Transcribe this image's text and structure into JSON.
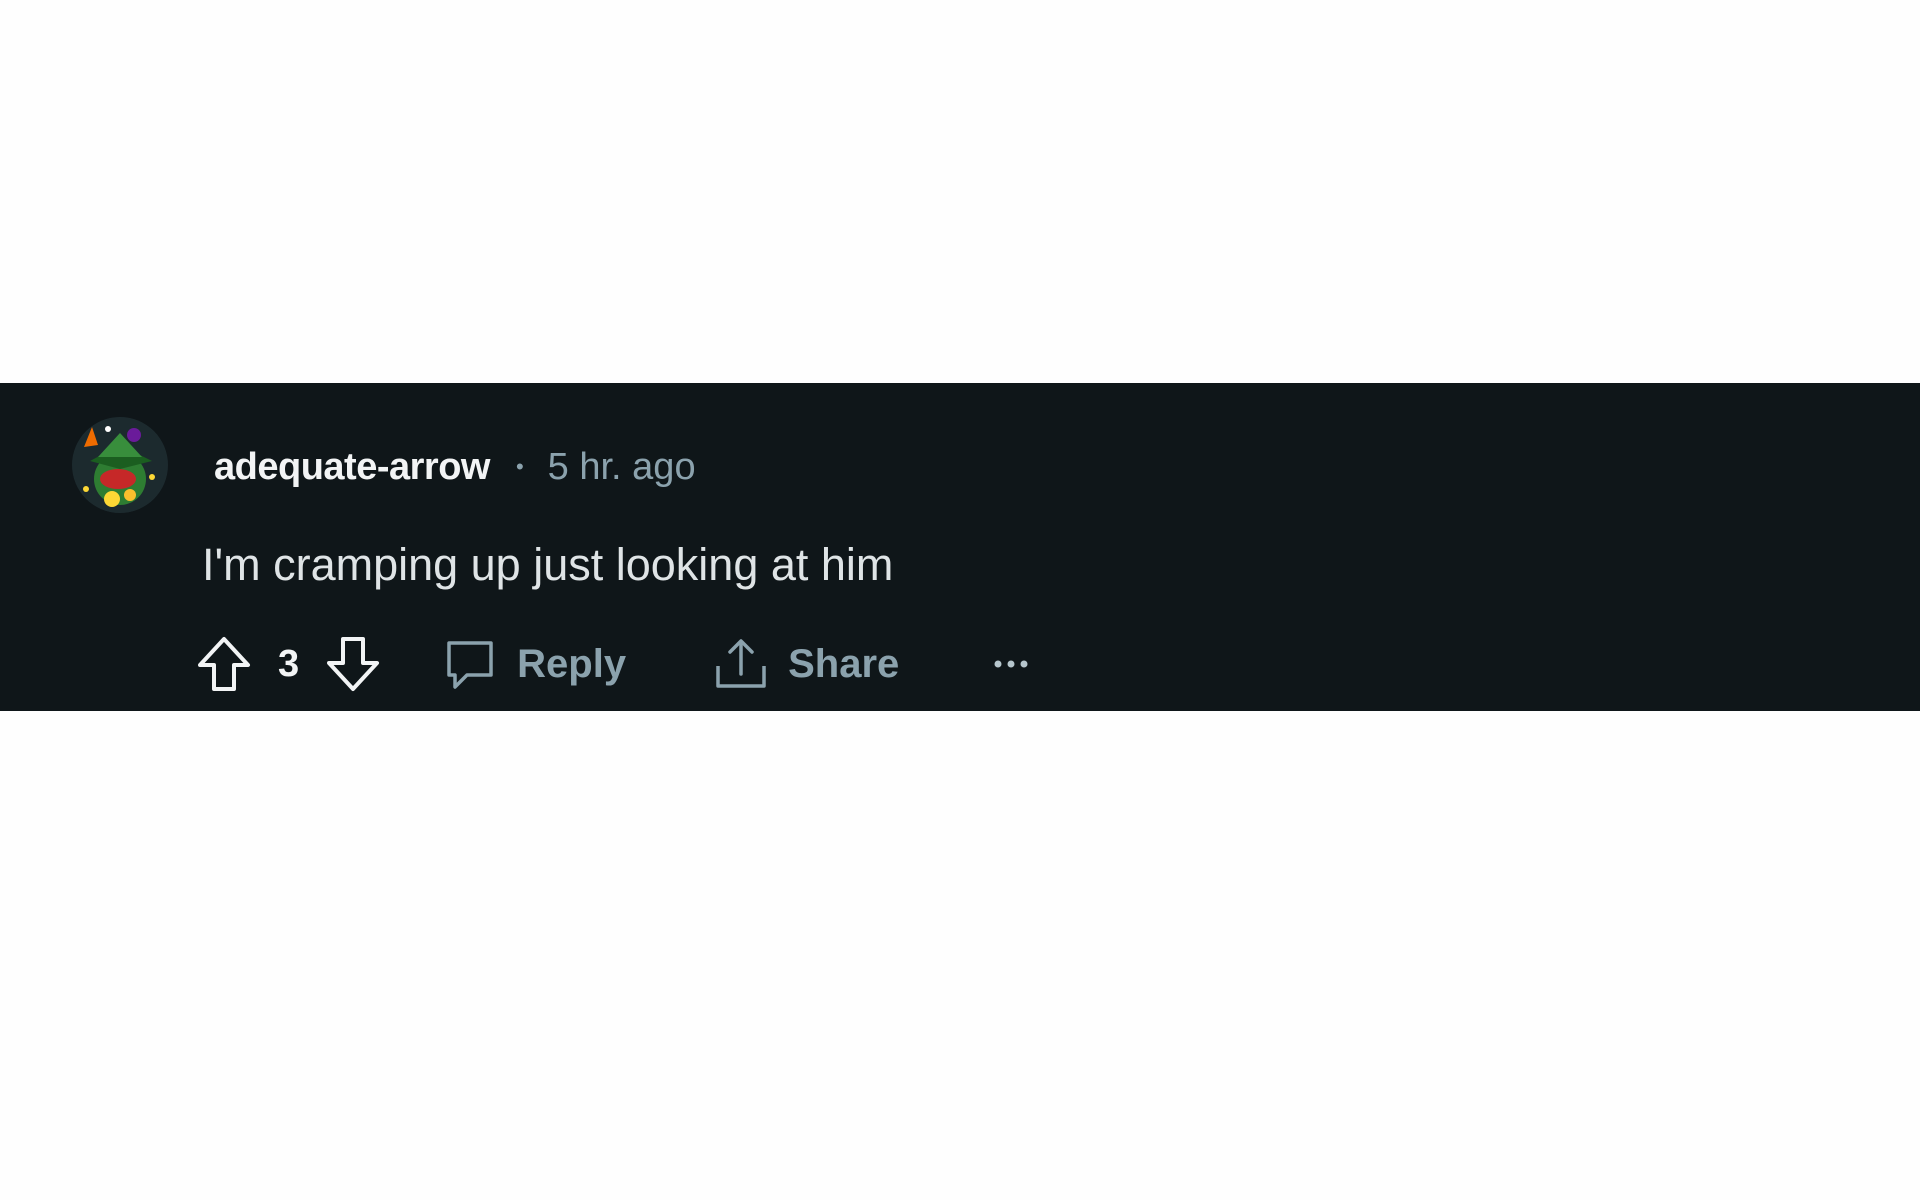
{
  "comment": {
    "author": "adequate-arrow",
    "separator": "•",
    "timestamp": "5 hr. ago",
    "text": "I'm cramping up just looking at him",
    "vote_count": "3",
    "reply_label": "Reply",
    "share_label": "Share",
    "more_label": "···"
  },
  "icons": {
    "upvote": "arrow-up-outline-icon",
    "downvote": "arrow-down-outline-icon",
    "reply": "speech-bubble-icon",
    "share": "share-upload-icon",
    "more": "ellipsis-icon"
  },
  "colors": {
    "card_background": "#0f1619",
    "author": "#f2f4f5",
    "muted": "#8ba2ad",
    "body_text": "#dfe4e6"
  }
}
